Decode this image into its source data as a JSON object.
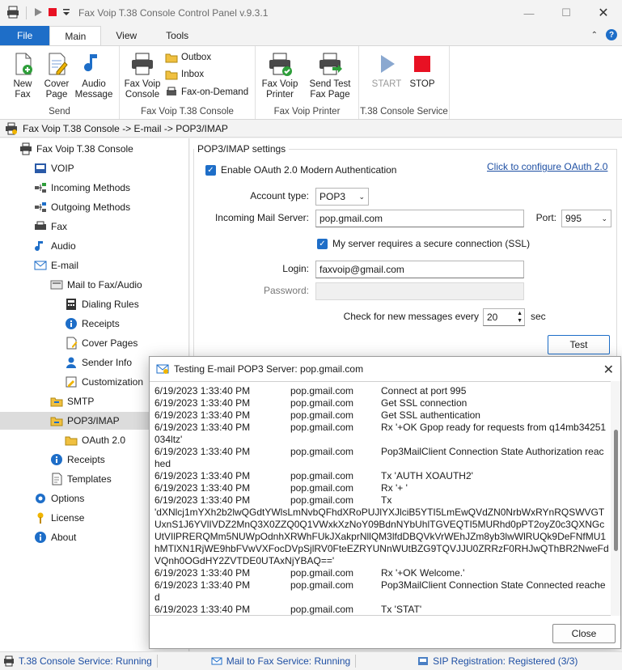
{
  "window": {
    "title": "Fax Voip T.38 Console Control Panel v.9.3.1"
  },
  "ribbon_tabs": [
    "File",
    "Main",
    "View",
    "Tools"
  ],
  "ribbon": {
    "send": {
      "label": "Send",
      "new_fax": "New\nFax",
      "cover_page": "Cover\nPage",
      "audio_message": "Audio\nMessage"
    },
    "console": {
      "label": "Fax Voip T.38 Console",
      "console_btn": "Fax Voip\nConsole",
      "outbox": "Outbox",
      "inbox": "Inbox",
      "fax_on_demand": "Fax-on-Demand"
    },
    "printer": {
      "label": "Fax Voip Printer",
      "printer_btn": "Fax Voip\nPrinter",
      "send_test": "Send Test\nFax Page"
    },
    "service": {
      "label": "T.38 Console Service",
      "start": "START",
      "stop": "STOP"
    }
  },
  "breadcrumb": "Fax Voip T.38 Console -> E-mail -> POP3/IMAP",
  "tree": [
    {
      "label": "Fax Voip T.38 Console",
      "icon": "console-icon",
      "level": 0
    },
    {
      "label": "VOIP",
      "icon": "voip-icon",
      "level": 1
    },
    {
      "label": "Incoming Methods",
      "icon": "incoming-methods-icon",
      "level": 1
    },
    {
      "label": "Outgoing Methods",
      "icon": "outgoing-methods-icon",
      "level": 1
    },
    {
      "label": "Fax",
      "icon": "fax-icon",
      "level": 1
    },
    {
      "label": "Audio",
      "icon": "audio-icon",
      "level": 1
    },
    {
      "label": "E-mail",
      "icon": "email-icon",
      "level": 1
    },
    {
      "label": "Mail to Fax/Audio",
      "icon": "mail-to-fax-icon",
      "level": 2
    },
    {
      "label": "Dialing Rules",
      "icon": "dialing-rules-icon",
      "level": 3
    },
    {
      "label": "Receipts",
      "icon": "info-icon",
      "level": 3
    },
    {
      "label": "Cover Pages",
      "icon": "cover-pages-icon",
      "level": 3
    },
    {
      "label": "Sender Info",
      "icon": "sender-info-icon",
      "level": 3
    },
    {
      "label": "Customization",
      "icon": "customization-icon",
      "level": 3
    },
    {
      "label": "SMTP",
      "icon": "smtp-icon",
      "level": 2
    },
    {
      "label": "POP3/IMAP",
      "icon": "pop3-icon",
      "level": 2,
      "selected": true
    },
    {
      "label": "OAuth 2.0",
      "icon": "oauth-icon",
      "level": 3
    },
    {
      "label": "Receipts",
      "icon": "info-icon",
      "level": 2
    },
    {
      "label": "Templates",
      "icon": "templates-icon",
      "level": 2
    },
    {
      "label": "Options",
      "icon": "options-icon",
      "level": 1
    },
    {
      "label": "License",
      "icon": "license-icon",
      "level": 1
    },
    {
      "label": "About",
      "icon": "info-icon",
      "level": 1
    }
  ],
  "settings": {
    "group_title": "POP3/IMAP settings",
    "enable_oauth": "Enable OAuth 2.0 Modern Authentication",
    "configure_oauth_link": "Click to configure OAuth 2.0",
    "account_type_label": "Account type:",
    "account_type_value": "POP3",
    "server_label": "Incoming Mail Server:",
    "server_value": "pop.gmail.com",
    "port_label": "Port:",
    "port_value": "995",
    "ssl_label": "My server requires a secure connection (SSL)",
    "login_label": "Login:",
    "login_value": "faxvoip@gmail.com",
    "password_label": "Password:",
    "password_value": "",
    "check_label": "Check for new messages every",
    "check_value": "20",
    "check_unit": "sec",
    "test_button": "Test"
  },
  "dialog": {
    "title": "Testing E-mail POP3 Server: pop.gmail.com",
    "close_button": "Close",
    "log": [
      {
        "time": "6/19/2023 1:33:40 PM",
        "host": "pop.gmail.com",
        "msg": "Connect at port 995"
      },
      {
        "time": "6/19/2023 1:33:40 PM",
        "host": "pop.gmail.com",
        "msg": "Get SSL connection"
      },
      {
        "time": "6/19/2023 1:33:40 PM",
        "host": "pop.gmail.com",
        "msg": "Get SSL authentication"
      },
      {
        "time": "6/19/2023 1:33:40 PM",
        "host": "pop.gmail.com",
        "msg": "Rx '+OK Gpop ready for requests from q14mb34251034ltz'"
      },
      {
        "time": "6/19/2023 1:33:40 PM",
        "host": "pop.gmail.com",
        "msg": "Pop3MailClient Connection State Authorization reached"
      },
      {
        "time": "6/19/2023 1:33:40 PM",
        "host": "pop.gmail.com",
        "msg": "Tx 'AUTH XOAUTH2'"
      },
      {
        "time": "6/19/2023 1:33:40 PM",
        "host": "pop.gmail.com",
        "msg": "Rx '+ '"
      },
      {
        "time": "6/19/2023 1:33:40 PM",
        "host": "pop.gmail.com",
        "msg": "Tx"
      },
      {
        "time": "",
        "host": "",
        "msg": "'dXNlcj1mYXh2b2lwQGdtYWlsLmNvbQFhdXRoPUJlYXJlciB5YTI5LmEwQVdZN0NrbWxRYnRQSWVGTUxnS1J6YVlIVDZ2MnQ3X0ZZQ0Q1VWxkXzNoY09BdnNYbUhlTGVEQTI5MURhd0pPT2oyZ0c3QXNGcUtVIlPRERQMm5NUWpOdnhXRWhFUkJXakprNllQM3lfdDBQVkVrWEhJZm8yb3lwWlRUQk9DeFNfMU1hMTlXN1RjWE9hbFVwVXFocDVpSjlRV0FteEZRYUNnWUtBZG9TQVJJU0ZRRzF0RHJwQThBR2NweFdVQnh0OGdHY2ZVTDE0UTAxNjYBAQ=='"
      },
      {
        "time": "6/19/2023 1:33:40 PM",
        "host": "pop.gmail.com",
        "msg": "Rx '+OK Welcome.'"
      },
      {
        "time": "6/19/2023 1:33:40 PM",
        "host": "pop.gmail.com",
        "msg": "Pop3MailClient Connection State Connected reached"
      },
      {
        "time": "6/19/2023 1:33:40 PM",
        "host": "pop.gmail.com",
        "msg": "Tx 'STAT'"
      }
    ]
  },
  "statusbar": {
    "service": "T.38 Console Service: Running",
    "mail_to_fax": "Mail to Fax Service: Running",
    "sip": "SIP Registration: Registered (3/3)"
  },
  "colors": {
    "accent": "#1e6ec8",
    "stop_red": "#e81123",
    "link": "#1e4fa3"
  }
}
